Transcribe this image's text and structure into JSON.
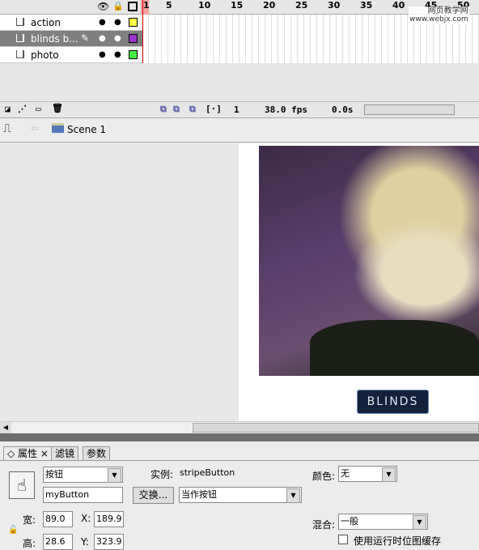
{
  "timeline": {
    "frame_numbers": [
      "1",
      "5",
      "10",
      "15",
      "20",
      "25",
      "30",
      "35",
      "40",
      "45",
      "50"
    ],
    "layers": [
      {
        "name": "action",
        "color": "#ffff44"
      },
      {
        "name": "blinds b...",
        "color": "#9933cc"
      },
      {
        "name": "photo",
        "color": "#44ee44"
      }
    ],
    "current_frame": "1",
    "fps": "38.0 fps",
    "time": "0.0s"
  },
  "scene": {
    "label": "Scene 1"
  },
  "watermark": {
    "line1": "网页教学网",
    "line2": "www.webjx.com"
  },
  "stage": {
    "button_label": "BLINDS"
  },
  "panel": {
    "tabs": [
      "属性",
      "滤镜",
      "参数"
    ],
    "symbol_type": "按钮",
    "instance_label": "实例:",
    "instance_name": "stripeButton",
    "instance_field": "myButton",
    "swap_button": "交换...",
    "track_as": "当作按钮",
    "color_label": "颜色:",
    "color_value": "无",
    "blend_label": "混合:",
    "blend_value": "一般",
    "cache_label": "使用运行时位图缓存",
    "w_label": "宽:",
    "w": "89.0",
    "h_label": "高:",
    "h": "28.6",
    "x_label": "X:",
    "x": "189.9",
    "y_label": "Y:",
    "y": "323.9"
  }
}
